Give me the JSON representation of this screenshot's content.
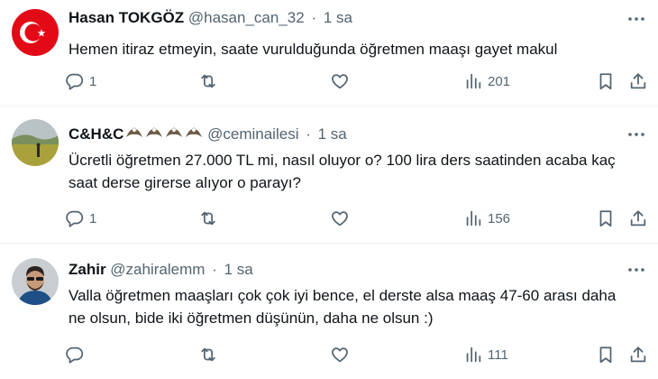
{
  "tweets": [
    {
      "name": "Hasan TOKGÖZ",
      "handle": "@hasan_can_32",
      "separator": "·",
      "time": "1 sa",
      "text": "Hemen itiraz etmeyin, saate vurulduğunda öğretmen maaşı gayet makul",
      "replies": "1",
      "reposts": "",
      "likes": "",
      "views": "201",
      "avatar": "turkish-flag"
    },
    {
      "name": "C&H&C",
      "name_emojis": [
        "eagle-emoji",
        "eagle-emoji",
        "eagle-emoji",
        "eagle-emoji"
      ],
      "handle": "@ceminailesi",
      "separator": "·",
      "time": "1 sa",
      "text": "Ücretli öğretmen 27.000 TL mi, nasıl oluyor o? 100 lira ders saatinden acaba kaç saat derse girerse alıyor o parayı?",
      "replies": "1",
      "reposts": "",
      "likes": "",
      "views": "156",
      "avatar": "landscape-photo"
    },
    {
      "name": "Zahir",
      "handle": "@zahiralemm",
      "separator": "·",
      "time": "1 sa",
      "text": "Valla öğretmen maaşları çok çok iyi bence, el derste alsa maaş 47-60 arası daha ne olsun, bide iki öğretmen düşünün, daha ne olsun :)",
      "replies": "",
      "reposts": "",
      "likes": "",
      "views": "111",
      "avatar": "man-photo"
    }
  ],
  "icons": {
    "reply": "reply-icon",
    "repost": "repost-icon",
    "like": "heart-icon",
    "views": "views-icon",
    "bookmark": "bookmark-icon",
    "share": "share-icon",
    "more": "more-icon"
  },
  "colors": {
    "text": "#0f1419",
    "secondary": "#536471",
    "flag_red": "#e30a17",
    "divider": "#eff3f4"
  }
}
